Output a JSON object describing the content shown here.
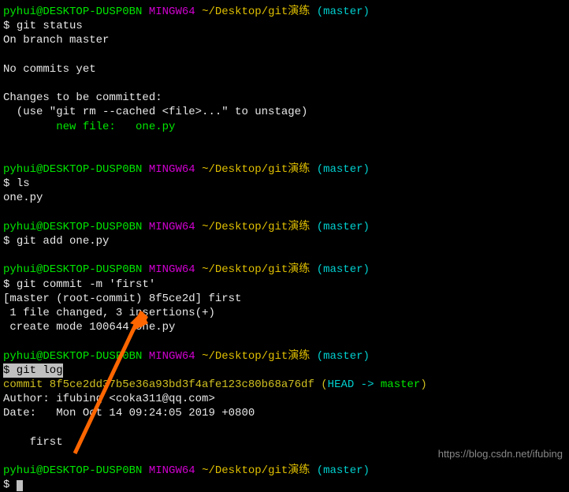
{
  "prompt": {
    "user": "pyhui@DESKTOP-DUSP0BN",
    "mingw": "MINGW64",
    "path": "~/Desktop/git演练",
    "branch": "(master)",
    "dollar": "$ "
  },
  "block1": {
    "cmd": "git status",
    "l1": "On branch master",
    "l2": "No commits yet",
    "l3": "Changes to be committed:",
    "l4": "  (use \"git rm --cached <file>...\" to unstage)",
    "l5": "        new file:   one.py"
  },
  "block2": {
    "cmd": "ls",
    "out": "one.py"
  },
  "block3": {
    "cmd": "git add one.py"
  },
  "block4": {
    "cmd": "git commit -m 'first'",
    "l1": "[master (root-commit) 8f5ce2d] first",
    "l2": " 1 file changed, 3 insertions(+)",
    "l3": " create mode 100644 one.py"
  },
  "block5": {
    "cmd": "$ git log",
    "l1a": "commit 8f5ce2dd37b5e36a93bd3f4afe123c80b68a76df (",
    "l1b": "HEAD -> ",
    "l1c": "master",
    "l1d": ")",
    "l2": "Author: ifubing <coka311@qq.com>",
    "l3": "Date:   Mon Oct 14 09:24:05 2019 +0800",
    "l4": "    first"
  },
  "watermark": "https://blog.csdn.net/ifubing"
}
